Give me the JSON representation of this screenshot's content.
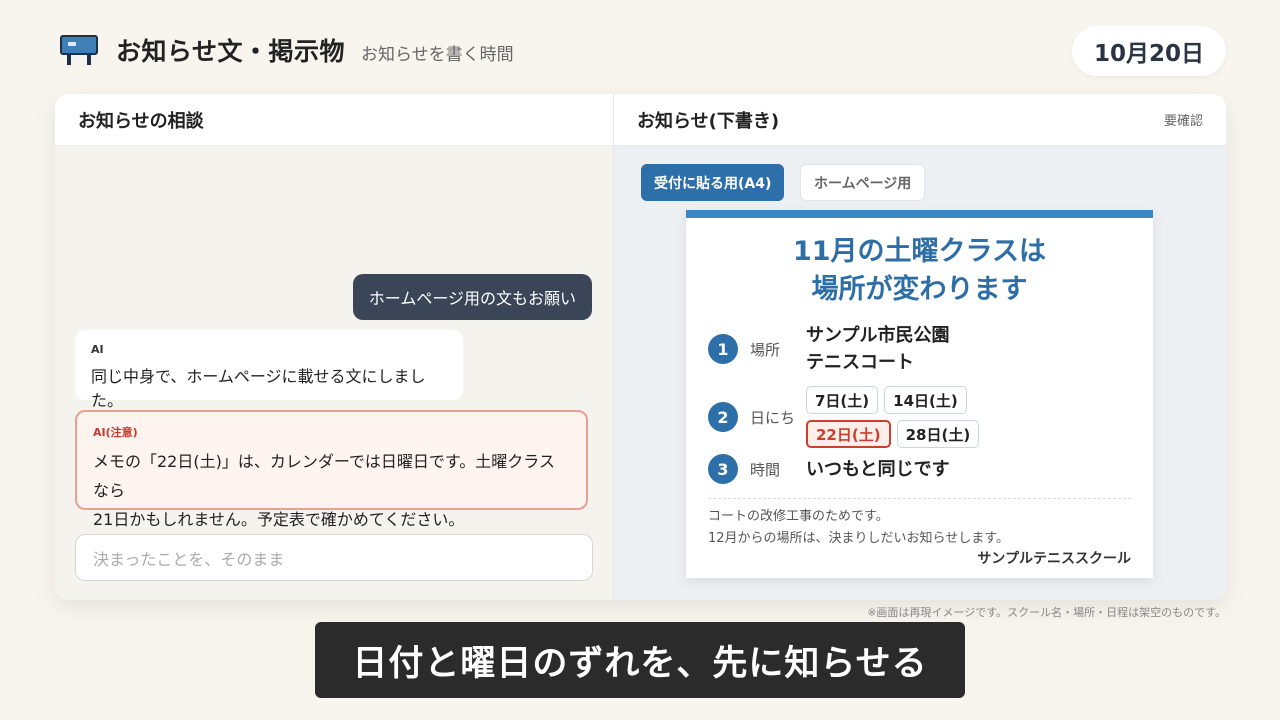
{
  "header": {
    "icon": "bulletin-board-icon",
    "title": "お知らせ文・掲示物",
    "subtitle": "お知らせを書く時間",
    "date": "10月20日"
  },
  "left_pane": {
    "title": "お知らせの相談",
    "messages": {
      "user": "ホームページ用の文もお願い",
      "ai_label": "AI",
      "ai_text": "同じ中身で、ホームページに載せる文にしました。",
      "warn_label": "AI(注意)",
      "warn_line1": "メモの「22日(土)」は、カレンダーでは日曜日です。土曜クラスなら",
      "warn_line2": "21日かもしれません。予定表で確かめてください。"
    },
    "input_placeholder": "決まったことを、そのまま"
  },
  "right_pane": {
    "title": "お知らせ(下書き)",
    "status": "要確認",
    "tabs": [
      "受付に貼る用(A4)",
      "ホームページ用"
    ],
    "notice": {
      "title_line1": "11月の土曜クラスは",
      "title_line2": "場所が変わります",
      "rows": [
        {
          "num": "1",
          "label": "場所",
          "value_line1": "サンプル市民公園",
          "value_line2": "テニスコート"
        },
        {
          "num": "2",
          "label": "日にち",
          "chips": [
            "7日(土)",
            "14日(土)",
            "22日(土)",
            "28日(土)"
          ]
        },
        {
          "num": "3",
          "label": "時間",
          "value": "いつもと同じです"
        }
      ],
      "note_line1": "コートの改修工事のためです。",
      "note_line2": "12月からの場所は、決まりしだいお知らせします。",
      "signer": "サンプルテニススクール"
    }
  },
  "disclaimer": "※画面は再現イメージです。スクール名・場所・日程は架空のものです。",
  "caption": "日付と曜日のずれを、先に知らせる",
  "colors": {
    "accent": "#2d6fa8",
    "warning": "#c9402c",
    "user_bubble": "#3a4657"
  }
}
